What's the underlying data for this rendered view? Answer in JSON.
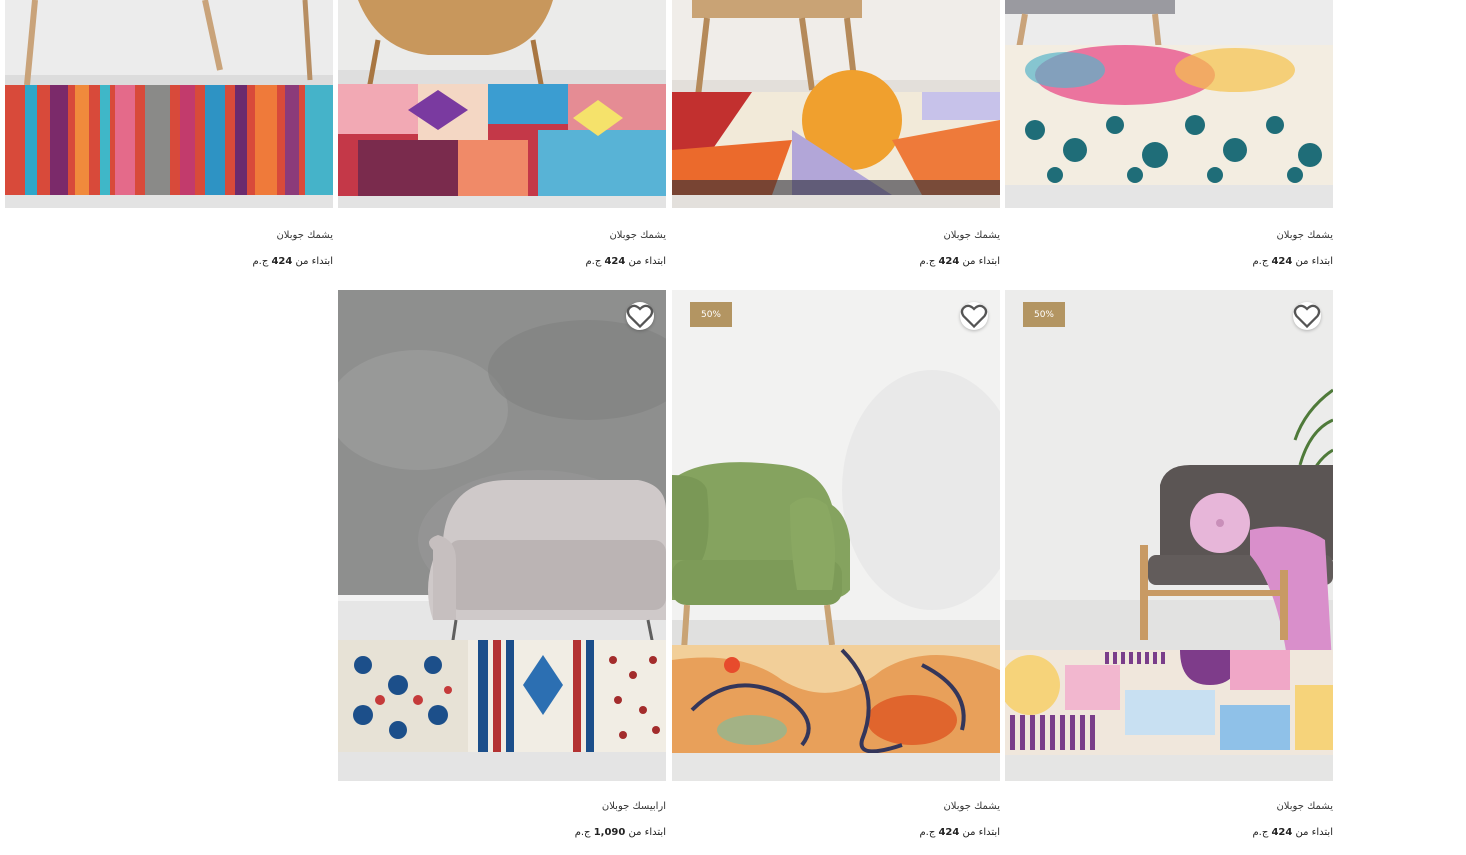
{
  "products_row1": [
    {
      "title": "يشمك جوبلان",
      "price_prefix": "ابتداء من",
      "price": "424",
      "currency": "ج.م"
    },
    {
      "title": "يشمك جوبلان",
      "price_prefix": "ابتداء من",
      "price": "424",
      "currency": "ج.م"
    },
    {
      "title": "يشمك جوبلان",
      "price_prefix": "ابتداء من",
      "price": "424",
      "currency": "ج.م"
    },
    {
      "title": "يشمك جوبلان",
      "price_prefix": "ابتداء من",
      "price": "424",
      "currency": "ج.م"
    }
  ],
  "products_row2": [
    {
      "title": "ارابيسك جوبلان",
      "price_prefix": "ابتداء من",
      "price": "1,090",
      "currency": "ج.م",
      "badge": ""
    },
    {
      "title": "يشمك جوبلان",
      "price_prefix": "ابتداء من",
      "price": "424",
      "currency": "ج.م",
      "badge": "50%"
    },
    {
      "title": "يشمك جوبلان",
      "price_prefix": "ابتداء من",
      "price": "424",
      "currency": "ج.م",
      "badge": "50%"
    }
  ],
  "colors": {
    "badge": "#b39562"
  }
}
